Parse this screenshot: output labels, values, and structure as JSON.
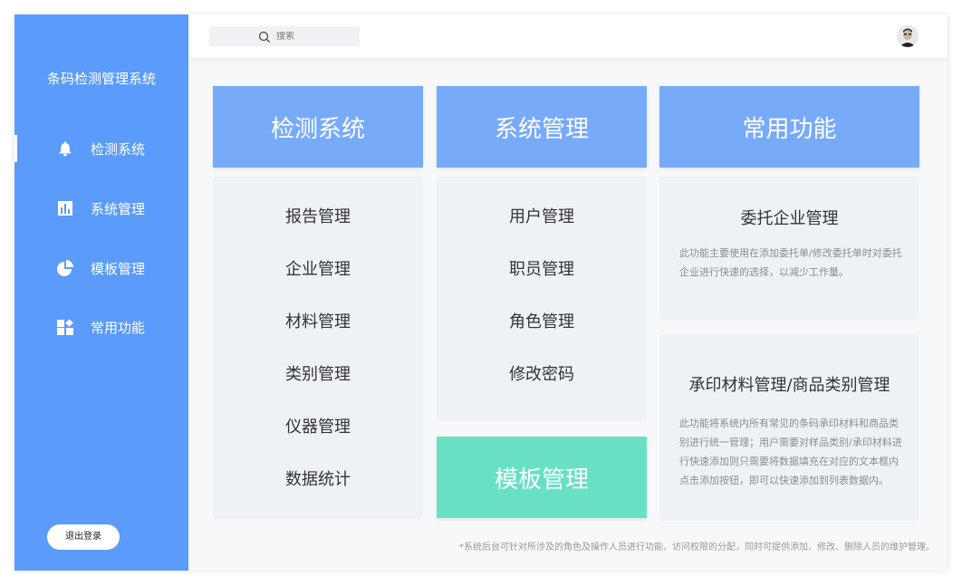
{
  "sidebar": {
    "brand": "条码检测管理系统",
    "items": [
      {
        "label": "检测系统",
        "icon": "bell-icon"
      },
      {
        "label": "系统管理",
        "icon": "bar-chart-icon"
      },
      {
        "label": "模板管理",
        "icon": "pie-chart-icon"
      },
      {
        "label": "常用功能",
        "icon": "apps-icon"
      }
    ],
    "logout_label": "退出登录"
  },
  "topbar": {
    "search_placeholder": "搜索"
  },
  "columns": {
    "detection": {
      "title": "检测系统",
      "items": [
        "报告管理",
        "企业管理",
        "材料管理",
        "类别管理",
        "仪器管理",
        "数据统计"
      ]
    },
    "system": {
      "title": "系统管理",
      "items": [
        "用户管理",
        "职员管理",
        "角色管理",
        "修改密码"
      ]
    },
    "template": {
      "title": "模板管理"
    },
    "common": {
      "title": "常用功能",
      "cards": [
        {
          "title": "委托企业管理",
          "desc": "此功能主要使用在添加委托单/修改委托单时对委托企业进行快速的选择，以减少工作量。"
        },
        {
          "title": "承印材料管理/商品类别管理",
          "desc": "此功能将系统内所有常见的条码承印材料和商品类别进行统一管理；用户需要对样品类别/承印材料进行快速添加则只需要将数据填充在对应的文本框内点击添加按钮，即可以快速添加到列表数据内。"
        }
      ]
    }
  },
  "footnote": "*系统后台可针对所涉及的角色及操作人员进行功能、访问权限的分配，同时可提供添加、修改、删除人员的维护管理。",
  "colors": {
    "sidebar": "#5b9bfb",
    "header_card": "#78aafa",
    "template_card": "#68e0c4",
    "panel": "#eef2f7"
  }
}
